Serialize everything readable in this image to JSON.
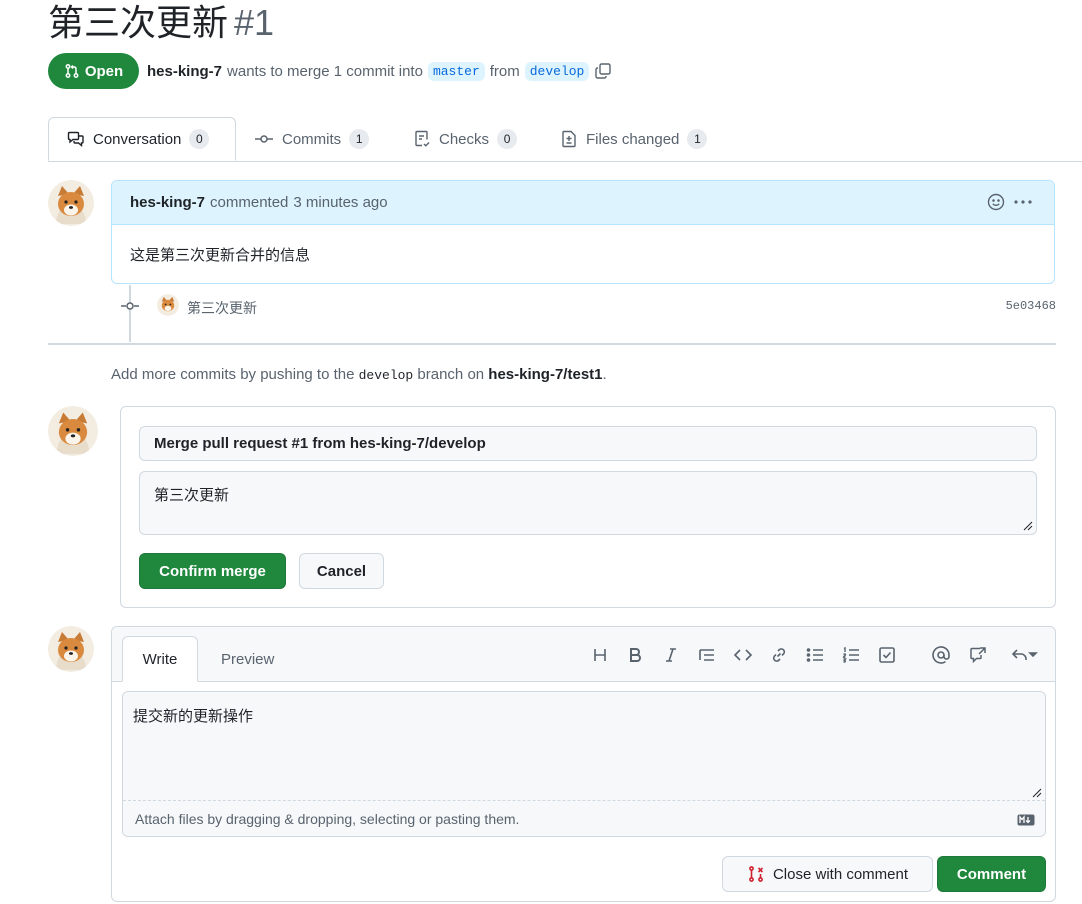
{
  "pr": {
    "title": "第三次更新",
    "number": "#1",
    "status": "Open",
    "author": "hes-king-7",
    "merge_text": "wants to merge 1 commit into",
    "base_branch": "master",
    "from_text": "from",
    "head_branch": "develop"
  },
  "tabs": [
    {
      "label": "Conversation",
      "count": "0"
    },
    {
      "label": "Commits",
      "count": "1"
    },
    {
      "label": "Checks",
      "count": "0"
    },
    {
      "label": "Files changed",
      "count": "1"
    }
  ],
  "comment": {
    "author": "hes-king-7",
    "action": "commented",
    "time": "3 minutes ago",
    "body": "这是第三次更新合并的信息"
  },
  "commit": {
    "message": "第三次更新",
    "hash": "5e03468"
  },
  "hint": {
    "prefix": "Add more commits by pushing to the",
    "branch": "develop",
    "middle": "branch on",
    "repo": "hes-king-7/test1",
    "suffix": "."
  },
  "merge": {
    "title_value": "Merge pull request #1 from hes-king-7/develop",
    "body_value": "第三次更新",
    "confirm_label": "Confirm merge",
    "cancel_label": "Cancel"
  },
  "new_comment": {
    "write_tab": "Write",
    "preview_tab": "Preview",
    "text": "提交新的更新操作",
    "attach_hint": "Attach files by dragging & dropping, selecting or pasting them.",
    "close_label": "Close with comment",
    "comment_label": "Comment"
  },
  "colors": {
    "green": "#1f883d",
    "blue_bg": "#ddf4ff",
    "blue_text": "#0969da",
    "close_red": "#cf222e"
  }
}
